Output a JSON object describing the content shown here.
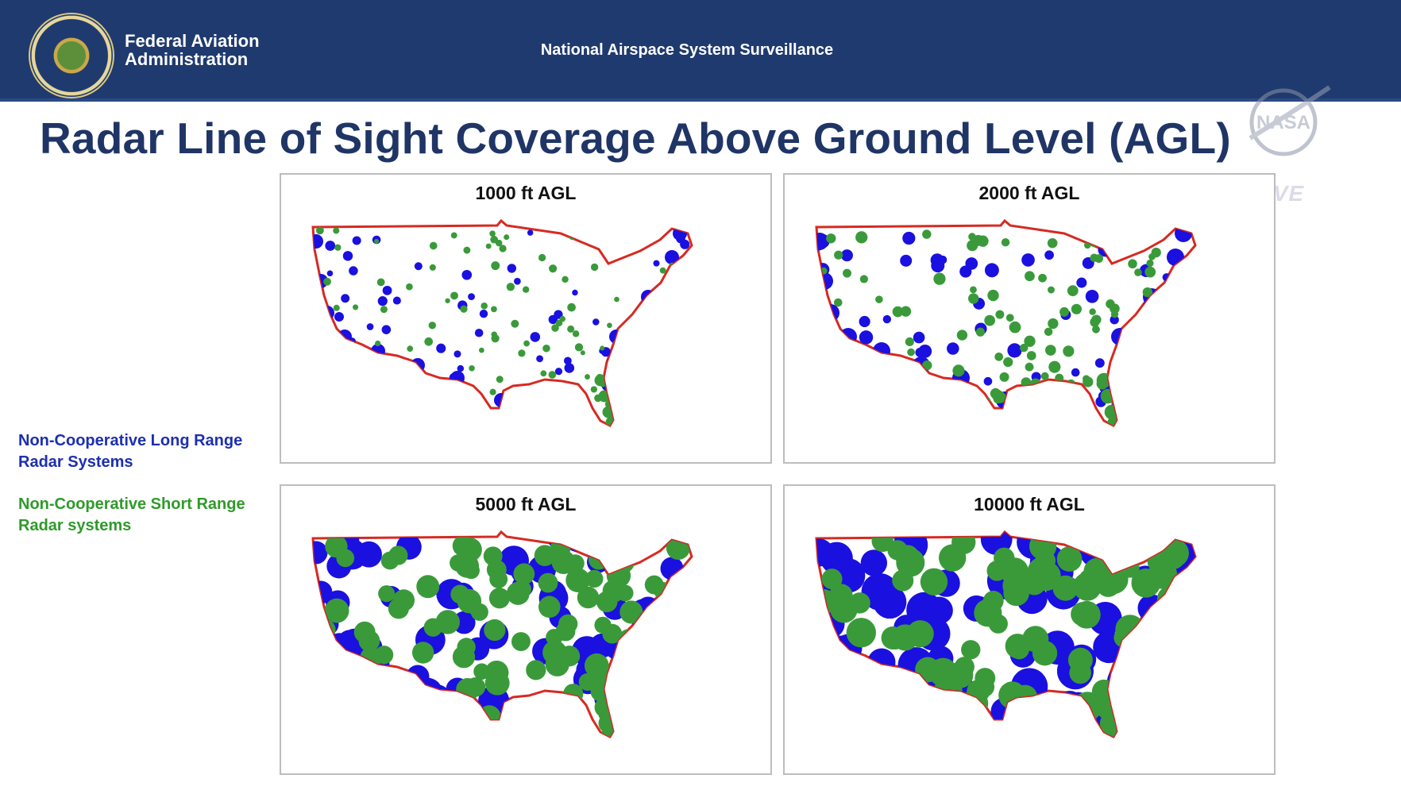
{
  "header": {
    "agency_line1": "Federal Aviation",
    "agency_line2": "Administration",
    "subtitle": "National Airspace System Surveillance",
    "seal_icon": "faa-seal-icon",
    "background_color": "#1f3a6e"
  },
  "title": "Radar Line of Sight Coverage Above Ground Level (AGL)",
  "watermark": {
    "logo": "nasa-logo",
    "live": "LIVE"
  },
  "legend": {
    "long_range": {
      "line1": "Non-Cooperative Long Range",
      "line2": "Radar Systems",
      "color": "#1a10e0"
    },
    "short_range": {
      "line1": "Non-Cooperative Short Range",
      "line2": "Radar systems",
      "color": "#3a9a3a"
    }
  },
  "boundary_color": "#d62a22",
  "panels": [
    {
      "label": "1000 ft AGL",
      "altitude_ft": 1000
    },
    {
      "label": "2000 ft AGL",
      "altitude_ft": 2000
    },
    {
      "label": "5000 ft AGL",
      "altitude_ft": 5000
    },
    {
      "label": "10000 ft AGL",
      "altitude_ft": 10000
    }
  ]
}
